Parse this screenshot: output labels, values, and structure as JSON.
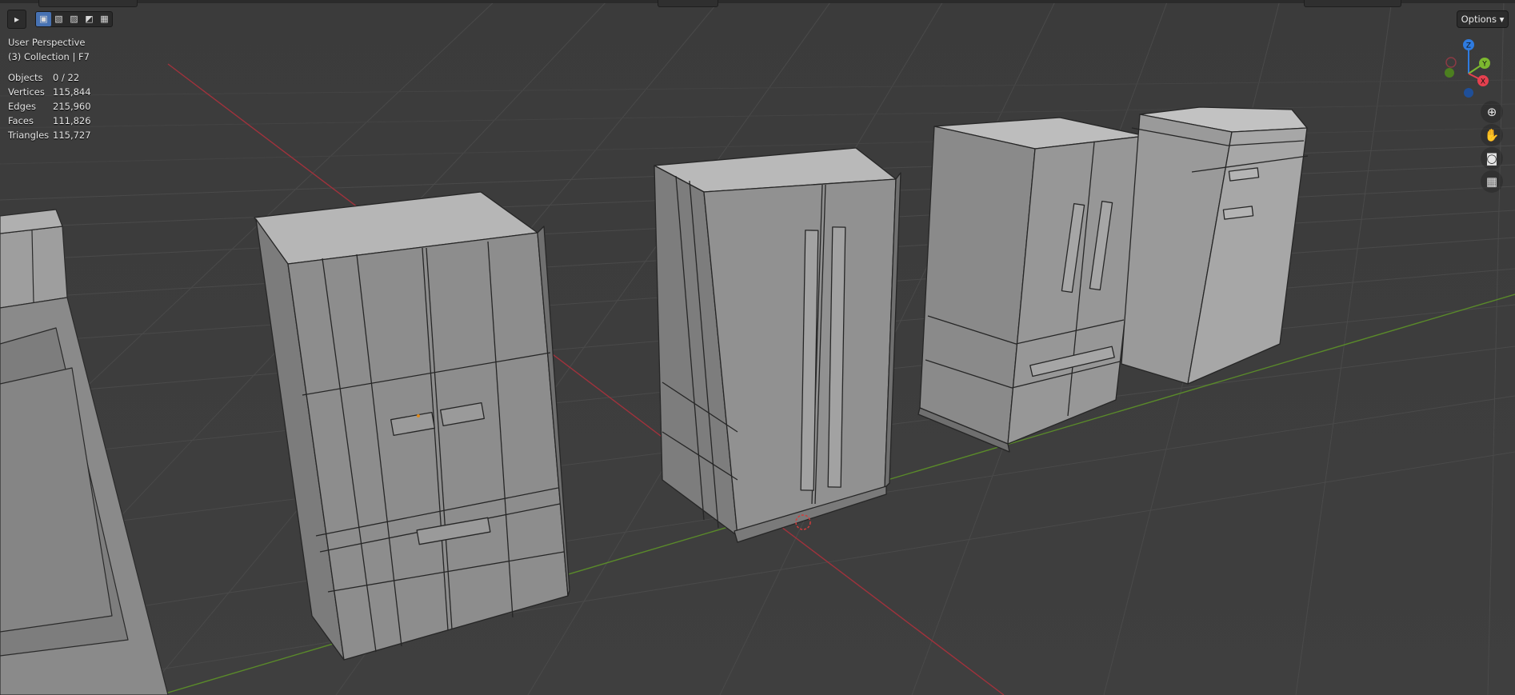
{
  "viewport": {
    "view_name": "User Perspective",
    "collection_info": "(3) Collection | F7",
    "stats": [
      {
        "label": "Objects",
        "value": "0 / 22"
      },
      {
        "label": "Vertices",
        "value": "115,844"
      },
      {
        "label": "Edges",
        "value": "215,960"
      },
      {
        "label": "Faces",
        "value": "111,826"
      },
      {
        "label": "Triangles",
        "value": "115,727"
      }
    ],
    "options_label": "Options"
  },
  "gizmo": {
    "z_label": "Z",
    "y_label": "Y",
    "x_label": "X",
    "colors": {
      "x": "#e6404f",
      "y": "#7cb82f",
      "z": "#2e7be0"
    }
  },
  "nav_icons": [
    "zoom-icon",
    "hand-icon",
    "camera-icon",
    "grid-icon"
  ],
  "colors": {
    "background": "#3d3d3d",
    "grid": "#474747",
    "x_axis": "#a0323c",
    "y_axis": "#5a8a2a",
    "model": "#8f8f8f",
    "accent": "#4772b3"
  }
}
